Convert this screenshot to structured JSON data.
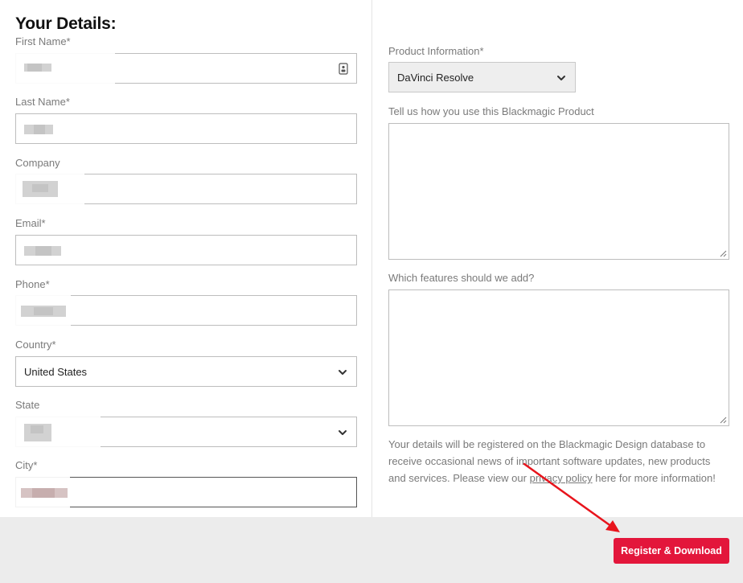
{
  "form": {
    "heading": "Your Details:",
    "first_name": {
      "label": "First Name*",
      "value": ""
    },
    "last_name": {
      "label": "Last Name*",
      "value": ""
    },
    "company": {
      "label": "Company",
      "value": ""
    },
    "email": {
      "label": "Email*",
      "value": ""
    },
    "phone": {
      "label": "Phone*",
      "value": ""
    },
    "country": {
      "label": "Country*",
      "value": "United States"
    },
    "state": {
      "label": "State",
      "value": ""
    },
    "city": {
      "label": "City*",
      "value": ""
    }
  },
  "product": {
    "label": "Product Information*",
    "value": "DaVinci Resolve"
  },
  "usage": {
    "label": "Tell us how you use this Blackmagic Product",
    "value": ""
  },
  "features": {
    "label": "Which features should we add?",
    "value": ""
  },
  "info": {
    "before_link": "Your details will be registered on the Blackmagic Design database to receive occasional news of important software updates, new products and services. Please view our ",
    "link": "privacy policy",
    "after_link": " here for more information!"
  },
  "submit_label": "Register & Download",
  "colors": {
    "accent": "#e3163b",
    "annotation_arrow": "#e8141c",
    "footer_bg": "#ececec"
  },
  "icons": {
    "autofill": "contact-card-icon",
    "dropdown": "chevron-down-icon",
    "resize": "resize-grip-icon"
  }
}
